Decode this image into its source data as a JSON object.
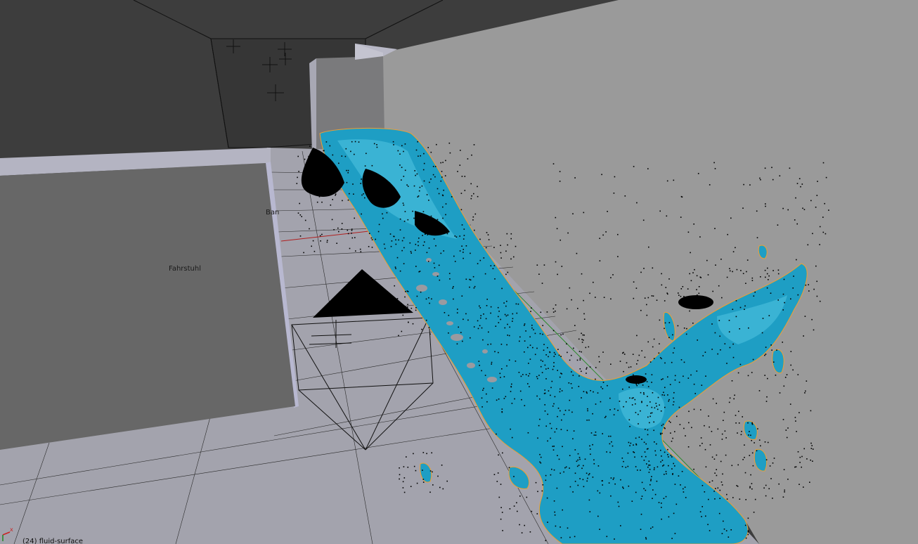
{
  "viewport": {
    "objects": [
      {
        "id": "elevator",
        "label": "Fahrstuhl"
      },
      {
        "id": "bank",
        "label": "Ban"
      }
    ],
    "status_text": "(24) fluid-surface",
    "axis_gizmo": {
      "x_label": "x"
    }
  },
  "colors": {
    "fluid": "#1e9ec4",
    "fluid_highlight": "#56c7e3",
    "fluid_outline": "#f0a030",
    "particles": "#000000",
    "back_wall": "#3c3c3c",
    "side_wall": "#9a9a9a",
    "floor": "#a3a3ad",
    "elevator_box": "#666666",
    "grid_line": "#222222",
    "axis_x": "#cc2222",
    "axis_y": "#228822"
  }
}
